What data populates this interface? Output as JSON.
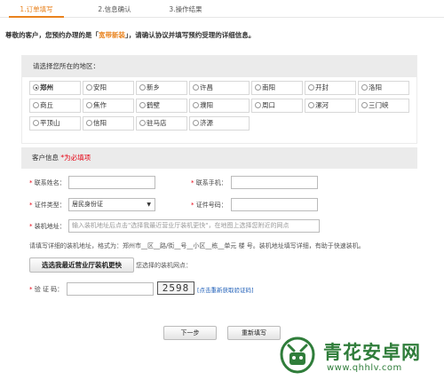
{
  "steps": [
    "1.订单填写",
    "2.信息确认",
    "3.操作结果"
  ],
  "intro": {
    "before": "尊敬的客户，您预约办理的是「",
    "product": "宽带新装",
    "after": "」，请确认协议并填写预约受理的详细信息。"
  },
  "region": {
    "heading": "请选择您所在的地区：",
    "selected": "郑州",
    "items": [
      "郑州",
      "安阳",
      "新乡",
      "许昌",
      "南阳",
      "开封",
      "洛阳",
      "商丘",
      "焦作",
      "鹤壁",
      "濮阳",
      "周口",
      "漯河",
      "三门峡",
      "平顶山",
      "信阳",
      "驻马店",
      "济源"
    ]
  },
  "customer": {
    "heading": "客户信息",
    "required_note": "*为必填项",
    "contact_name_label": "联系姓名：",
    "contact_phone_label": "联系手机：",
    "id_type_label": "证件类型：",
    "id_type_value": "居民身份证",
    "id_number_label": "证件号码：",
    "address_label": "装机地址：",
    "address_placeholder": "输入装机地址后点击\"选择我最近营业厅装机更快\"，在地图上选择您附近的网点",
    "address_hint": "请填写详细的装机地址，格式为：郑州市__区__路/街__号__小区__栋__单元 楼 号。装机地址填写详细，有助于快速装机。",
    "store_button": "选选我最近营业厅装机更快",
    "store_text": "您选择的装机网点：",
    "captcha_label": "验 证 码：",
    "captcha_code": "2598",
    "captcha_refresh": "[点击重新获取验证码]"
  },
  "actions": {
    "next": "下一步",
    "reset": "重新填写"
  },
  "watermark": {
    "title": "青花安卓网",
    "url": "www.qhhlv.com"
  }
}
